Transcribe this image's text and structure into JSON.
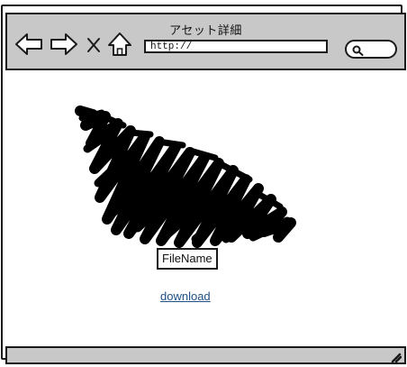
{
  "window": {
    "title": "アセット詳細"
  },
  "toolbar": {
    "back_icon": "back-arrow-icon",
    "forward_icon": "forward-arrow-icon",
    "stop_icon": "close-icon",
    "home_icon": "home-icon",
    "url_value": "http://",
    "search_icon": "search-icon"
  },
  "asset": {
    "image": "scribble-image-placeholder",
    "filename": "FileName",
    "download_label": "download"
  },
  "statusbar": {
    "grip_icon": "resize-grip-icon"
  },
  "colors": {
    "chrome": "#c8c8c8",
    "border": "#1a1a1a",
    "link": "#1f4f88"
  }
}
